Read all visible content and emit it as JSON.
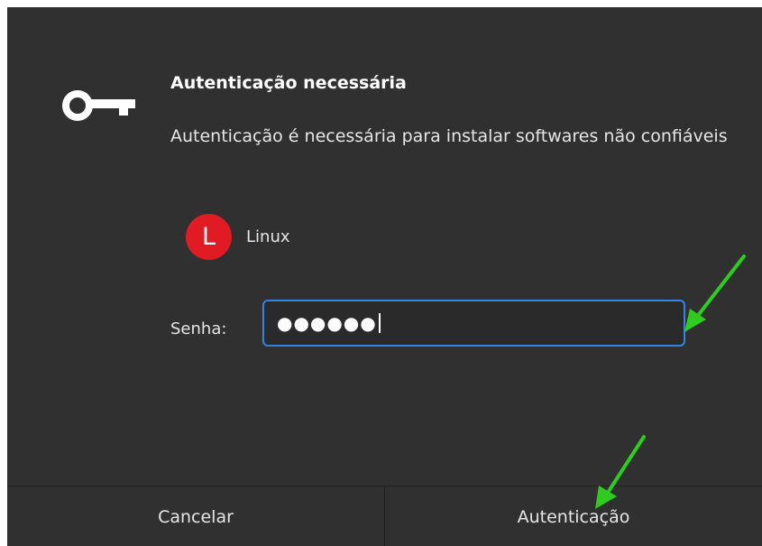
{
  "dialog": {
    "title": "Autenticação necessária",
    "description": "Autenticação é necessária para instalar softwares não confiáveis",
    "icon": "key-icon"
  },
  "user": {
    "avatar_letter": "L",
    "name": "Linux",
    "avatar_color": "#e01b24"
  },
  "password": {
    "label": "Senha:",
    "masked_value": "●●●●●●"
  },
  "buttons": {
    "cancel": "Cancelar",
    "authenticate": "Autenticação"
  },
  "annotations": {
    "arrow_color": "#2ecc1e"
  },
  "colors": {
    "dialog_bg": "#303030",
    "focus_border": "#3584e4"
  }
}
